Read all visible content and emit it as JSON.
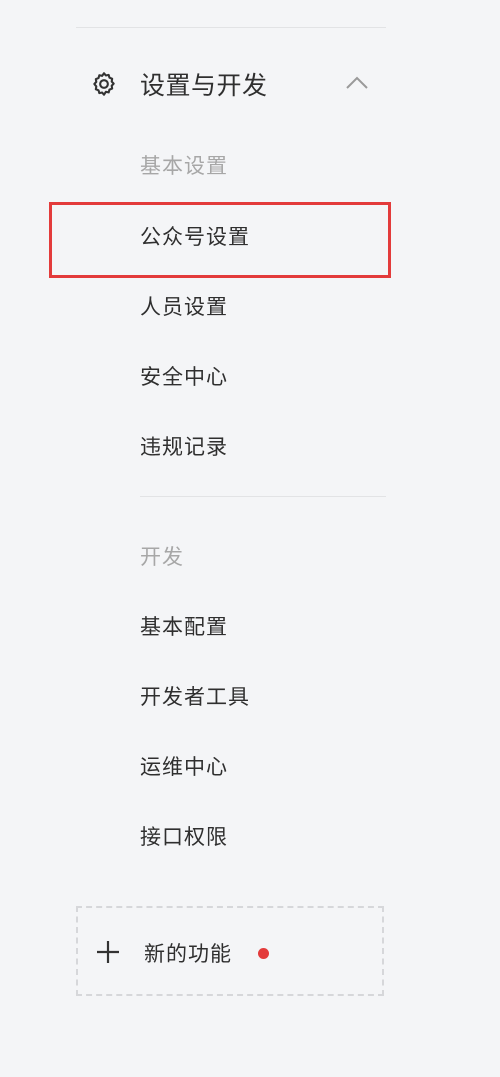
{
  "section": {
    "title": "设置与开发",
    "gear_icon": "gear-icon",
    "chevron_icon": "chevron-up-icon"
  },
  "basic_settings": {
    "label": "基本设置",
    "items": [
      {
        "label": "公众号设置",
        "highlighted": true
      },
      {
        "label": "人员设置"
      },
      {
        "label": "安全中心"
      },
      {
        "label": "违规记录"
      }
    ]
  },
  "development": {
    "label": "开发",
    "items": [
      {
        "label": "基本配置"
      },
      {
        "label": "开发者工具"
      },
      {
        "label": "运维中心"
      },
      {
        "label": "接口权限"
      }
    ]
  },
  "new_feature": {
    "label": "新的功能",
    "plus_icon": "plus-icon",
    "badge_color": "#e33b3b"
  },
  "colors": {
    "background": "#f4f5f7",
    "highlight": "#e33b3b",
    "muted_text": "#a7a7a7",
    "text": "#2f2f2f"
  }
}
